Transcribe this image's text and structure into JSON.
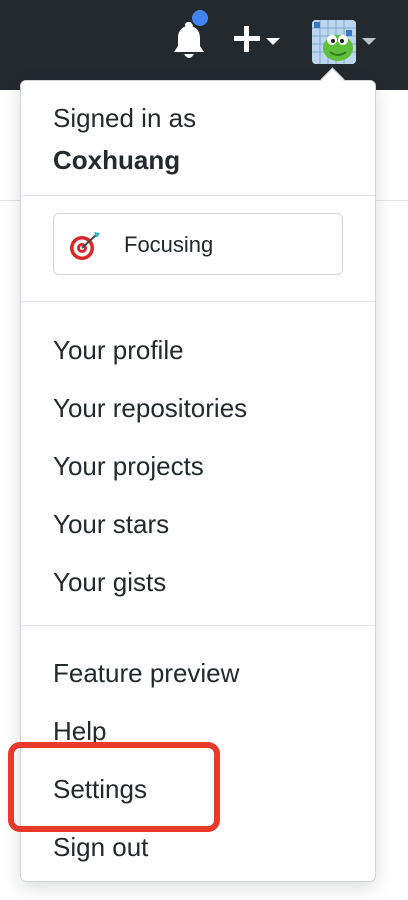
{
  "header": {
    "notifications": {
      "icon": "bell-icon",
      "has_unread": true,
      "dot_color": "#4184f0"
    },
    "create_menu": {
      "icon": "plus-icon"
    },
    "user_menu": {
      "icon": "avatar"
    }
  },
  "dropdown": {
    "signed_in_label": "Signed in as",
    "username": "Coxhuang",
    "status": {
      "emoji": "direct-hit-icon",
      "text": "Focusing"
    },
    "group1": [
      "Your profile",
      "Your repositories",
      "Your projects",
      "Your stars",
      "Your gists"
    ],
    "group2": [
      "Feature preview",
      "Help",
      "Settings",
      "Sign out"
    ]
  },
  "highlight": {
    "target": "Settings",
    "color": "#e8392b"
  },
  "colors": {
    "header_bg": "#24292e",
    "text": "#24292e",
    "border": "#d1d5da"
  }
}
